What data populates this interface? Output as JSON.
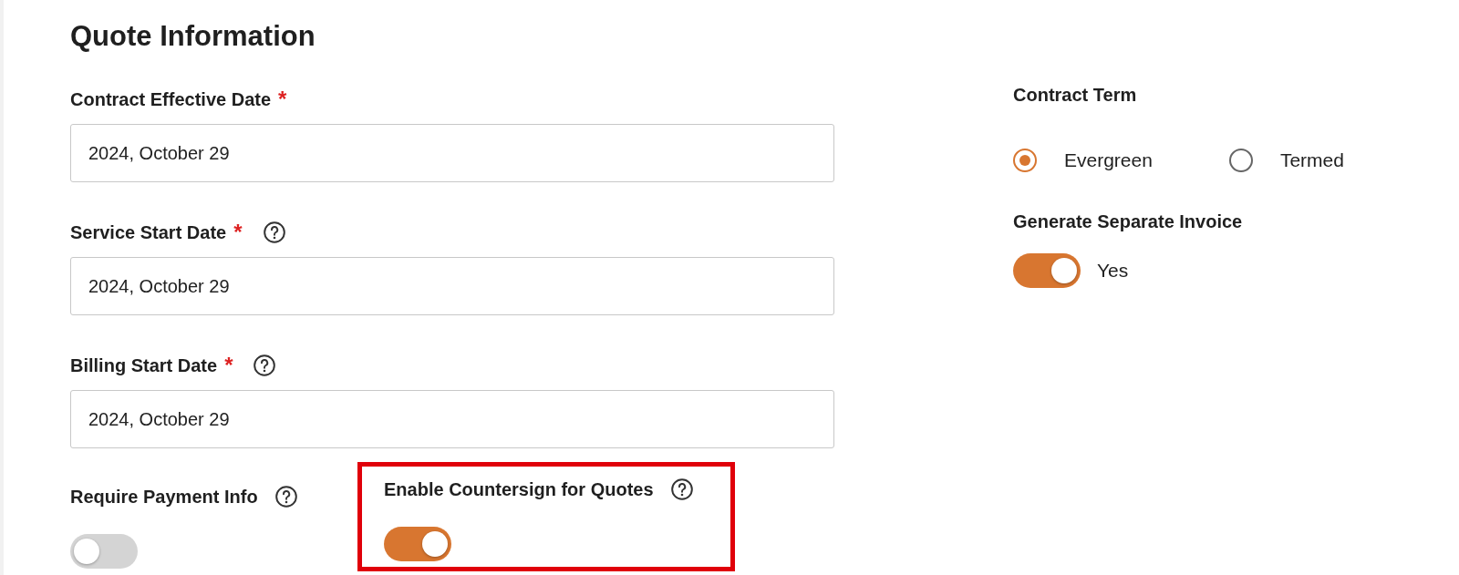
{
  "title": "Quote Information",
  "date_fields": [
    {
      "label": "Contract Effective Date",
      "required_mark": "*",
      "help": false,
      "value": "2024, October 29"
    },
    {
      "label": "Service Start Date",
      "required_mark": "*",
      "help": true,
      "value": "2024, October 29"
    },
    {
      "label": "Billing Start Date",
      "required_mark": "*",
      "help": true,
      "value": "2024, October 29"
    }
  ],
  "toggles": [
    {
      "label": "Require Payment Info",
      "help": true,
      "on": false,
      "highlighted": false
    },
    {
      "label": "Enable Countersign for Quotes",
      "help": true,
      "on": true,
      "highlighted": true
    }
  ],
  "contract_term": {
    "label": "Contract Term",
    "options": [
      {
        "label": "Evergreen",
        "selected": true
      },
      {
        "label": "Termed",
        "selected": false
      }
    ]
  },
  "separate_invoice": {
    "label": "Generate Separate Invoice",
    "on": true,
    "value": "Yes"
  }
}
